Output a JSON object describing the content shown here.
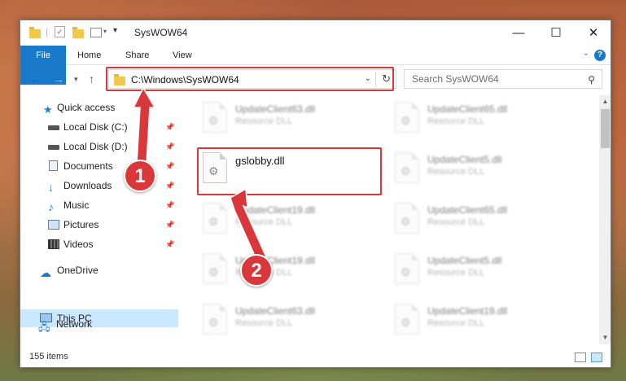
{
  "window": {
    "title": "SysWOW64",
    "controls": {
      "minimize": "—",
      "maximize": "☐",
      "close": "✕"
    }
  },
  "ribbon": {
    "tabs": [
      "File",
      "Home",
      "Share",
      "View"
    ],
    "help": "?"
  },
  "address": {
    "path": "C:\\Windows\\SysWOW64",
    "search_placeholder": "Search SysWOW64"
  },
  "nav_pane": {
    "items": [
      {
        "label": "Quick access",
        "icon": "star-icon"
      },
      {
        "label": "Local Disk (C:)",
        "icon": "drive-icon",
        "pinned": true
      },
      {
        "label": "Local Disk (D:)",
        "icon": "drive-icon",
        "pinned": true
      },
      {
        "label": "Documents",
        "icon": "documents-icon",
        "pinned": true
      },
      {
        "label": "Downloads",
        "icon": "download-icon",
        "pinned": true
      },
      {
        "label": "Music",
        "icon": "music-icon",
        "pinned": true
      },
      {
        "label": "Pictures",
        "icon": "pictures-icon",
        "pinned": true
      },
      {
        "label": "Videos",
        "icon": "video-icon",
        "pinned": true
      },
      {
        "label": "OneDrive",
        "icon": "cloud-icon"
      },
      {
        "label": "This PC",
        "icon": "computer-icon",
        "selected": true
      },
      {
        "label": "Network",
        "icon": "network-icon"
      }
    ]
  },
  "files": [
    {
      "name": "UpdateClient63.dll",
      "type": "Resource DLL"
    },
    {
      "name": "UpdateClient65.dll",
      "type": "Resource DLL"
    },
    {
      "name": "gslobby.dll",
      "type": ""
    },
    {
      "name": "UpdateClient5.dll",
      "type": "Resource DLL"
    },
    {
      "name": "UpdateClient19.dll",
      "type": "Resource DLL"
    },
    {
      "name": "UpdateClient65.dll",
      "type": "Resource DLL"
    },
    {
      "name": "UpdateClient19.dll",
      "type": "Resource DLL"
    },
    {
      "name": "UpdateClient5.dll",
      "type": "Resource DLL"
    },
    {
      "name": "UpdateClient63.dll",
      "type": "Resource DLL"
    },
    {
      "name": "UpdateClient19.dll",
      "type": "Resource DLL"
    }
  ],
  "status": {
    "item_count": "155 items"
  },
  "annotations": {
    "step1": "1",
    "step2": "2"
  },
  "colors": {
    "accent": "#1979ca",
    "highlight": "#d9373a",
    "selected": "#cce8ff"
  }
}
